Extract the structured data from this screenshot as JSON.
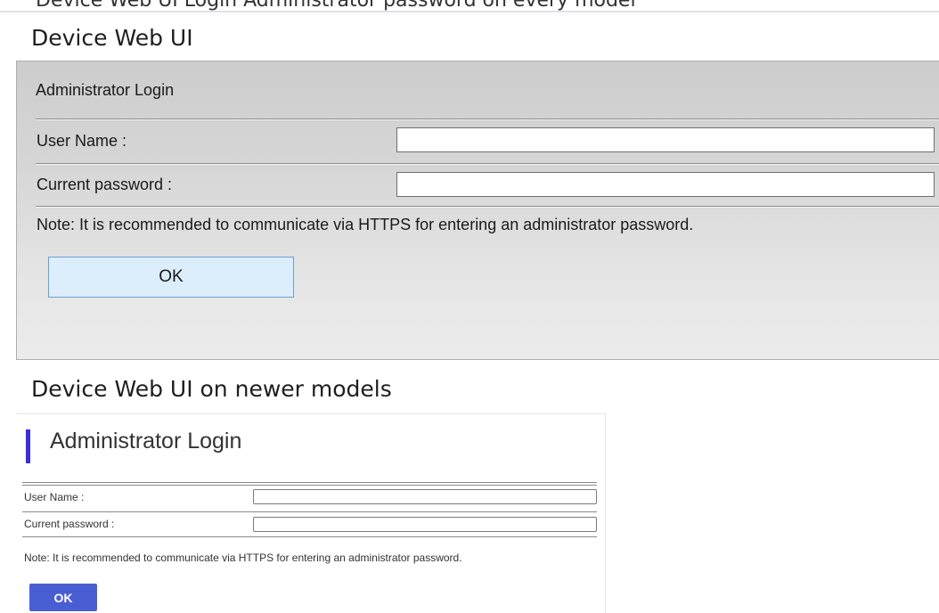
{
  "top_clipped_text": "Device Web UI Login Administrator password on every model",
  "sections": {
    "old": {
      "caption": "Device Web UI",
      "title": "Administrator Login",
      "username_label": "User Name :",
      "username_value": "",
      "password_label": "Current password :",
      "password_value": "",
      "note": "Note: It is recommended to communicate via HTTPS for entering an administrator password.",
      "ok_label": "OK"
    },
    "new": {
      "caption": "Device Web UI on newer models",
      "title": "Administrator Login",
      "username_label": "User Name :",
      "username_value": "",
      "password_label": "Current password :",
      "password_value": "",
      "note": "Note: It is recommended to communicate via HTTPS for entering an administrator password.",
      "ok_label": "OK"
    }
  },
  "colors": {
    "old_ok_background": "#dcedfb",
    "old_ok_border": "#6aa1d6",
    "new_accent": "#3b2fd6",
    "new_ok_background": "#4a5ed4"
  }
}
